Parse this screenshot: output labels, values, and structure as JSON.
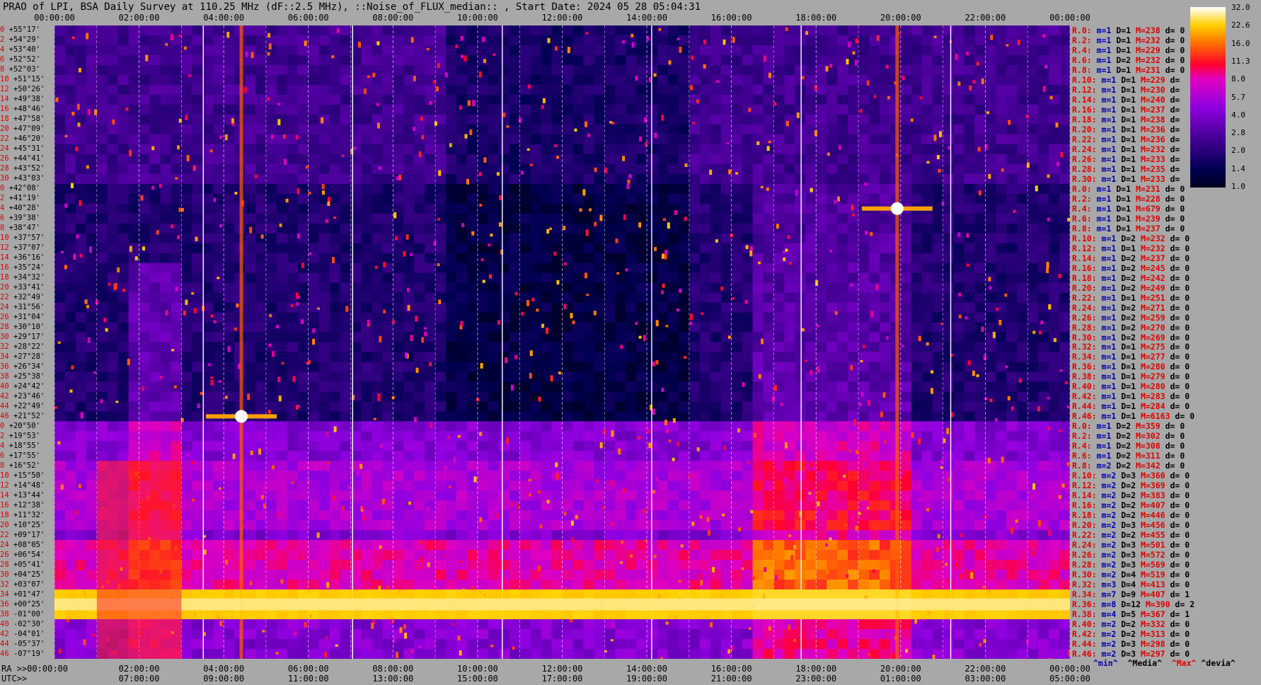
{
  "title": "PRAO of LPI, BSA Daily Survey at 110.25 MHz (dF::2.5 MHz), ::Noise_of_FLUX_median:: , Start Date: 2024 05 28 05:04:31",
  "top_axis": [
    "00:00:00",
    "02:00:00",
    "04:00:00",
    "06:00:00",
    "08:00:00",
    "10:00:00",
    "12:00:00",
    "14:00:00",
    "16:00:00",
    "18:00:00",
    "20:00:00",
    "22:00:00",
    "00:00:00"
  ],
  "bottom_ra": [
    "RA >>00:00:00",
    "02:00:00",
    "04:00:00",
    "06:00:00",
    "08:00:00",
    "10:00:00",
    "12:00:00",
    "14:00:00",
    "16:00:00",
    "18:00:00",
    "20:00:00",
    "22:00:00",
    "00:00:00"
  ],
  "bottom_utc": [
    "UTC>>",
    "07:00:00",
    "09:00:00",
    "11:00:00",
    "13:00:00",
    "15:00:00",
    "17:00:00",
    "19:00:00",
    "21:00:00",
    "23:00:00",
    "01:00:00",
    "03:00:00",
    "05:00:00"
  ],
  "declinations": [
    "+55°17'",
    "+54°29'",
    "+53°40'",
    "+52°52'",
    "+52°03'",
    "+51°15'",
    "+50°26'",
    "+49°38'",
    "+48°46'",
    "+47°58'",
    "+47°09'",
    "+46°20'",
    "+45°31'",
    "+44°41'",
    "+43°52'",
    "+43°03'",
    "+42°08'",
    "+41°19'",
    "+40°28'",
    "+39°38'",
    "+38°47'",
    "+37°57'",
    "+37°07'",
    "+36°16'",
    "+35°24'",
    "+34°32'",
    "+33°41'",
    "+32°49'",
    "+31°56'",
    "+31°04'",
    "+30°10'",
    "+29°17'",
    "+28°22'",
    "+27°28'",
    "+26°34'",
    "+25°38'",
    "+24°42'",
    "+23°46'",
    "+22°49'",
    "+21°52'",
    "+20°50'",
    "+19°53'",
    "+18°55'",
    "+17°55'",
    "+16°52'",
    "+15°50'",
    "+14°48'",
    "+13°44'",
    "+12°38'",
    "+11°32'",
    "+10°25'",
    "+09°17'",
    "+08°05'",
    "+06°54'",
    "+05°41'",
    "+04°25'",
    "+03°07'",
    "+01°47'",
    "+00°25'",
    "-01°00'",
    "-02°30'",
    "-04°01'",
    "-05°37'",
    "-07°19'"
  ],
  "decl_index": [
    "0",
    "2",
    "4",
    "6",
    "8",
    "10",
    "12",
    "14",
    "16",
    "18",
    "20",
    "22",
    "24",
    "26",
    "28",
    "30",
    "0",
    "2",
    "4",
    "6",
    "8",
    "10",
    "12",
    "14",
    "16",
    "18",
    "20",
    "22",
    "24",
    "26",
    "28",
    "30",
    "32",
    "34",
    "36",
    "38",
    "40",
    "42",
    "44",
    "46",
    "0",
    "2",
    "4",
    "6",
    "8",
    "10",
    "12",
    "14",
    "16",
    "18",
    "20",
    "22",
    "24",
    "26",
    "28",
    "30",
    "32",
    "34",
    "36",
    "38",
    "40",
    "42",
    "44",
    "46"
  ],
  "row_stats": [
    [
      "R.0:",
      "m=1",
      "D=1",
      "M=238",
      "d= 0"
    ],
    [
      "R.2:",
      "m=1",
      "D=1",
      "M=232",
      "d= 0"
    ],
    [
      "R.4:",
      "m=1",
      "D=1",
      "M=229",
      "d= 0"
    ],
    [
      "R.6:",
      "m=1",
      "D=2",
      "M=232",
      "d= 0"
    ],
    [
      "R.8:",
      "m=1",
      "D=1",
      "M=231",
      "d= 0"
    ],
    [
      "R.10:",
      "m=1",
      "D=1",
      "M=229",
      "d="
    ],
    [
      "R.12:",
      "m=1",
      "D=1",
      "M=230",
      "d="
    ],
    [
      "R.14:",
      "m=1",
      "D=1",
      "M=240",
      "d="
    ],
    [
      "R.16:",
      "m=1",
      "D=1",
      "M=237",
      "d="
    ],
    [
      "R.18:",
      "m=1",
      "D=1",
      "M=238",
      "d="
    ],
    [
      "R.20:",
      "m=1",
      "D=1",
      "M=236",
      "d="
    ],
    [
      "R.22:",
      "m=1",
      "D=1",
      "M=236",
      "d="
    ],
    [
      "R.24:",
      "m=1",
      "D=1",
      "M=232",
      "d="
    ],
    [
      "R.26:",
      "m=1",
      "D=1",
      "M=233",
      "d="
    ],
    [
      "R.28:",
      "m=1",
      "D=1",
      "M=235",
      "d="
    ],
    [
      "R.30:",
      "m=1",
      "D=1",
      "M=233",
      "d="
    ],
    [
      "R.0:",
      "m=1",
      "D=1",
      "M=231",
      "d= 0"
    ],
    [
      "R.2:",
      "m=1",
      "D=1",
      "M=228",
      "d= 0"
    ],
    [
      "R.4:",
      "m=1",
      "D=1",
      "M=679",
      "d= 0"
    ],
    [
      "R.6:",
      "m=1",
      "D=1",
      "M=239",
      "d= 0"
    ],
    [
      "R.8:",
      "m=1",
      "D=1",
      "M=237",
      "d= 0"
    ],
    [
      "R.10:",
      "m=1",
      "D=2",
      "M=232",
      "d= 0"
    ],
    [
      "R.12:",
      "m=1",
      "D=1",
      "M=232",
      "d= 0"
    ],
    [
      "R.14:",
      "m=1",
      "D=2",
      "M=237",
      "d= 0"
    ],
    [
      "R.16:",
      "m=1",
      "D=2",
      "M=245",
      "d= 0"
    ],
    [
      "R.18:",
      "m=1",
      "D=2",
      "M=242",
      "d= 0"
    ],
    [
      "R.20:",
      "m=1",
      "D=2",
      "M=249",
      "d= 0"
    ],
    [
      "R.22:",
      "m=1",
      "D=1",
      "M=251",
      "d= 0"
    ],
    [
      "R.24:",
      "m=1",
      "D=2",
      "M=271",
      "d= 0"
    ],
    [
      "R.26:",
      "m=1",
      "D=2",
      "M=259",
      "d= 0"
    ],
    [
      "R.28:",
      "m=1",
      "D=2",
      "M=270",
      "d= 0"
    ],
    [
      "R.30:",
      "m=1",
      "D=2",
      "M=269",
      "d= 0"
    ],
    [
      "R.32:",
      "m=1",
      "D=1",
      "M=275",
      "d= 0"
    ],
    [
      "R.34:",
      "m=1",
      "D=1",
      "M=277",
      "d= 0"
    ],
    [
      "R.36:",
      "m=1",
      "D=1",
      "M=280",
      "d= 0"
    ],
    [
      "R.38:",
      "m=1",
      "D=1",
      "M=279",
      "d= 0"
    ],
    [
      "R.40:",
      "m=1",
      "D=1",
      "M=280",
      "d= 0"
    ],
    [
      "R.42:",
      "m=1",
      "D=1",
      "M=283",
      "d= 0"
    ],
    [
      "R.44:",
      "m=1",
      "D=1",
      "M=284",
      "d= 0"
    ],
    [
      "R.46:",
      "m=1",
      "D=1",
      "M=6163",
      "d= 0"
    ],
    [
      "R.0:",
      "m=1",
      "D=2",
      "M=359",
      "d= 0"
    ],
    [
      "R.2:",
      "m=1",
      "D=2",
      "M=302",
      "d= 0"
    ],
    [
      "R.4:",
      "m=1",
      "D=2",
      "M=308",
      "d= 0"
    ],
    [
      "R.6:",
      "m=1",
      "D=2",
      "M=311",
      "d= 0"
    ],
    [
      "R.8:",
      "m=2",
      "D=2",
      "M=342",
      "d= 0"
    ],
    [
      "R.10:",
      "m=2",
      "D=3",
      "M=360",
      "d= 0"
    ],
    [
      "R.12:",
      "m=2",
      "D=2",
      "M=369",
      "d= 0"
    ],
    [
      "R.14:",
      "m=2",
      "D=2",
      "M=383",
      "d= 0"
    ],
    [
      "R.16:",
      "m=2",
      "D=2",
      "M=407",
      "d= 0"
    ],
    [
      "R.18:",
      "m=2",
      "D=2",
      "M=446",
      "d= 0"
    ],
    [
      "R.20:",
      "m=2",
      "D=3",
      "M=456",
      "d= 0"
    ],
    [
      "R.22:",
      "m=2",
      "D=2",
      "M=455",
      "d= 0"
    ],
    [
      "R.24:",
      "m=2",
      "D=3",
      "M=501",
      "d= 0"
    ],
    [
      "R.26:",
      "m=2",
      "D=3",
      "M=572",
      "d= 0"
    ],
    [
      "R.28:",
      "m=2",
      "D=3",
      "M=569",
      "d= 0"
    ],
    [
      "R.30:",
      "m=2",
      "D=4",
      "M=519",
      "d= 0"
    ],
    [
      "R.32:",
      "m=3",
      "D=4",
      "M=413",
      "d= 0"
    ],
    [
      "R.34:",
      "m=7",
      "D=9",
      "M=407",
      "d= 1"
    ],
    [
      "R.36:",
      "m=8",
      "D=12",
      "M=390",
      "d= 2"
    ],
    [
      "R.38:",
      "m=4",
      "D=5",
      "M=367",
      "d= 1"
    ],
    [
      "R.40:",
      "m=2",
      "D=2",
      "M=332",
      "d= 0"
    ],
    [
      "R.42:",
      "m=2",
      "D=2",
      "M=313",
      "d= 0"
    ],
    [
      "R.44:",
      "m=2",
      "D=3",
      "M=298",
      "d= 0"
    ],
    [
      "R.46:",
      "m=2",
      "D=3",
      "M=297",
      "d= 0"
    ]
  ],
  "legend": {
    "min": "^min^",
    "median": "^Media^",
    "max": "^Max^",
    "devia": "^devia^"
  },
  "colorbar_ticks": [
    "32.0",
    "22.6",
    "16.0",
    "11.3",
    "8.0",
    "5.7",
    "4.0",
    "2.8",
    "2.0",
    "1.4",
    "1.0"
  ],
  "chart_data": {
    "type": "heatmap",
    "title": "PRAO of LPI, BSA Daily Survey at 110.25 MHz (dF::2.5 MHz), ::Noise_of_FLUX_median:: , Start Date: 2024 05 28 05:04:31",
    "x_axis_top": "Sidereal time 00:00:00 to 24:00:00",
    "x_axis_bottom": "UTC 05:00:00 to 05:00:00",
    "y_axis": "Declination +55°17' to -07°19'",
    "colorscale_range": [
      1.0,
      32.0
    ],
    "colorscale_log": true,
    "features": [
      {
        "kind": "bright_point_source",
        "ra": "04:25",
        "dec": "+21°52'",
        "level": 32
      },
      {
        "kind": "bright_point_source",
        "ra": "19:55",
        "dec": "+40°28'",
        "level": 32
      },
      {
        "kind": "bright_band",
        "dec_range": [
          "+01°47'",
          "-01°00'"
        ],
        "level": 16
      },
      {
        "kind": "enhanced_region",
        "ra_range": [
          "01:00",
          "03:00"
        ],
        "dec_range": [
          "+16°52'",
          "-07°19'"
        ],
        "level": 8
      }
    ]
  }
}
